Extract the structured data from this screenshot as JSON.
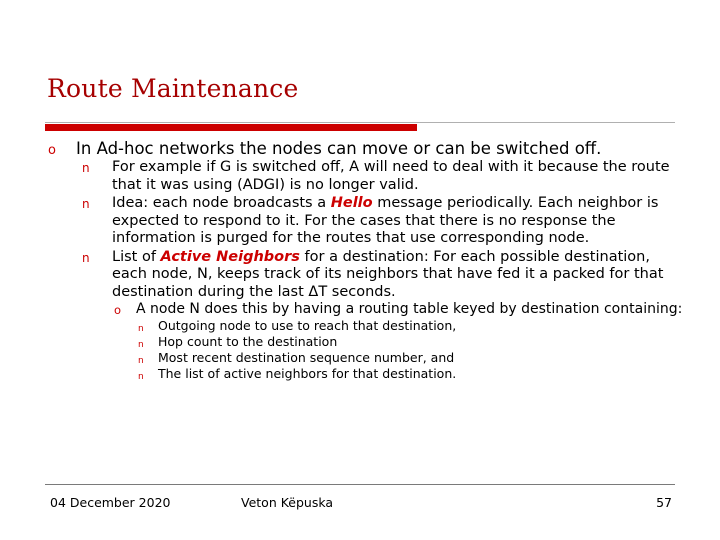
{
  "slide": {
    "title": "Route Maintenance",
    "bullets": {
      "b1": {
        "marker": "o",
        "text": "In Ad-hoc networks the nodes can move or can be switched off."
      },
      "b2a": {
        "marker": "n",
        "text": "For example if G is switched off, A will need to deal with it because the route that it was using (ADGI) is no longer valid."
      },
      "b2b": {
        "marker": "n",
        "text_1": "Idea: each node broadcasts a ",
        "emph": "Hello",
        "text_2": " message periodically. Each neighbor is expected to respond to it. For the cases that there is no response the information is purged for the routes that use corresponding node."
      },
      "b2c": {
        "marker": "n",
        "text_1": "List of ",
        "emph": "Active Neighbors",
        "text_2": " for a destination: For each possible destination, each node, N, keeps track of its neighbors that have fed it a packed for that destination during the last ΔT seconds."
      },
      "b3": {
        "marker": "o",
        "text": "A node N does this by having a routing table keyed by destination containing:"
      },
      "b4": {
        "marker": "n",
        "items": [
          "Outgoing node to use to reach that destination,",
          "Hop count to the destination",
          "Most recent destination sequence number, and",
          "The list of active neighbors for that destination."
        ]
      }
    },
    "footer": {
      "date": "04 December 2020",
      "author": "Veton Këpuska",
      "page": "57"
    },
    "colors": {
      "title": "#a60000",
      "accent_bar": "#cc0000",
      "highlight": "#cc0000"
    }
  }
}
